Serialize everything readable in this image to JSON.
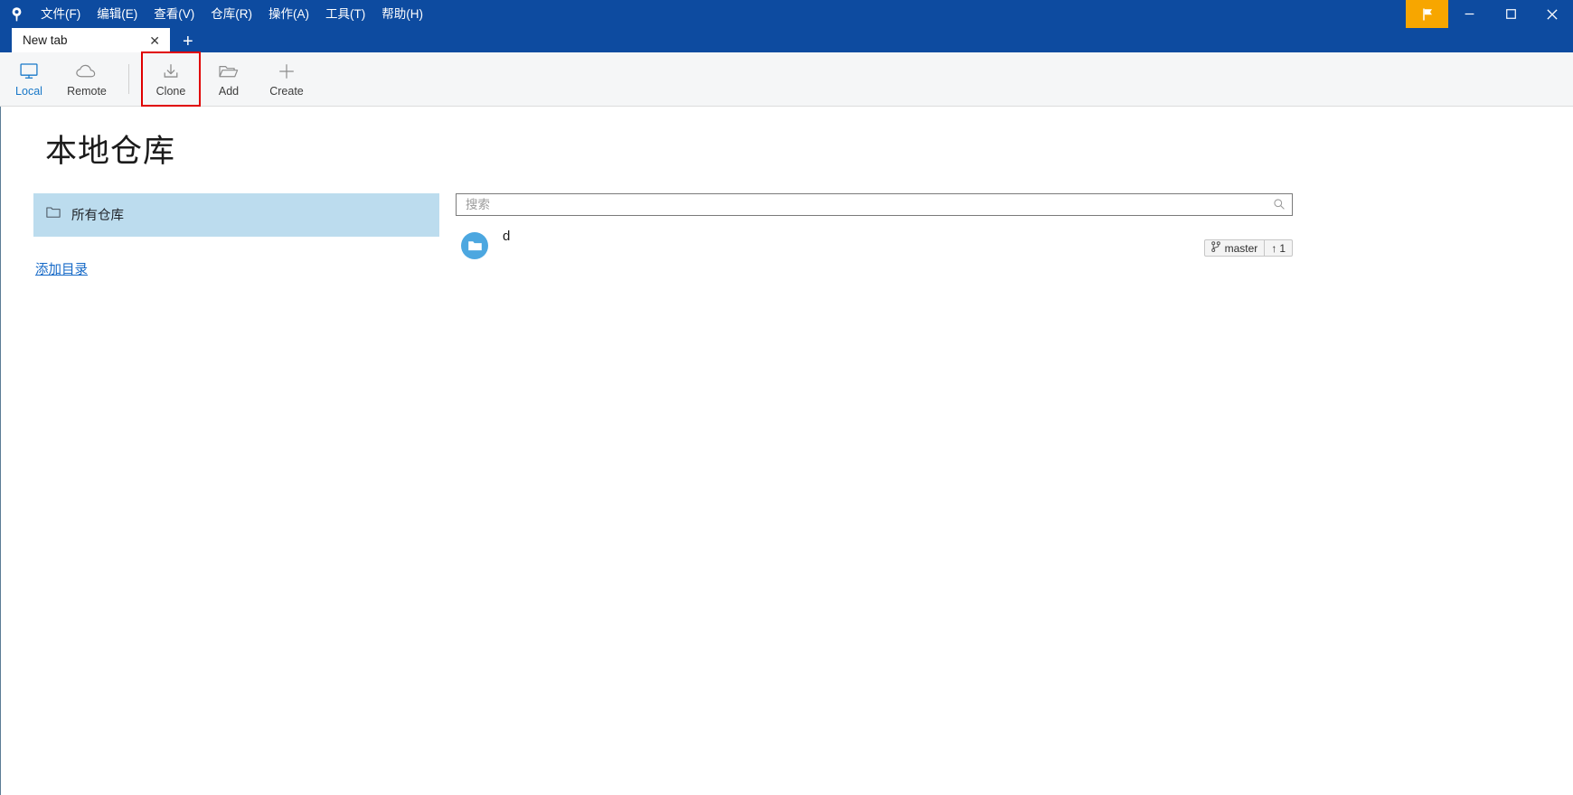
{
  "window": {
    "logo_icon": "smartgit-pin-icon",
    "menus": [
      {
        "label": "文件(F)",
        "name": "menu-file"
      },
      {
        "label": "编辑(E)",
        "name": "menu-edit"
      },
      {
        "label": "查看(V)",
        "name": "menu-view"
      },
      {
        "label": "仓库(R)",
        "name": "menu-repository"
      },
      {
        "label": "操作(A)",
        "name": "menu-actions"
      },
      {
        "label": "工具(T)",
        "name": "menu-tools"
      },
      {
        "label": "帮助(H)",
        "name": "menu-help"
      }
    ],
    "controls": {
      "flag_icon": "flag-icon",
      "minimize_icon": "minimize-icon",
      "maximize_icon": "maximize-icon",
      "close_icon": "close-icon"
    },
    "accent_color": "#0d4ba0",
    "flag_color": "#f7a600"
  },
  "tabs": {
    "items": [
      {
        "label": "New tab",
        "close_glyph": "✕"
      }
    ],
    "new_tab_glyph": "+"
  },
  "toolbar": {
    "left_buttons": [
      {
        "label": "Local",
        "icon": "monitor-icon",
        "active": true
      },
      {
        "label": "Remote",
        "icon": "cloud-icon",
        "active": false
      }
    ],
    "right_buttons": [
      {
        "label": "Clone",
        "icon": "download-icon",
        "highlighted": true
      },
      {
        "label": "Add",
        "icon": "folder-open-icon",
        "highlighted": false
      },
      {
        "label": "Create",
        "icon": "plus-icon",
        "highlighted": false
      }
    ],
    "highlight_color": "#e00000"
  },
  "main": {
    "title": "本地仓库",
    "left": {
      "group_label": "所有仓库",
      "group_icon": "folder-icon",
      "group_bg": "#bcdcee",
      "add_directory_label": "添加目录",
      "link_color": "#1569c7"
    },
    "right": {
      "search": {
        "placeholder": "搜索",
        "value": "",
        "icon": "search-icon"
      },
      "repositories": [
        {
          "name": "d",
          "avatar_icon": "folder-icon",
          "avatar_color": "#4ca7e0",
          "branch": "master",
          "branch_icon": "branch-icon",
          "ahead_glyph": "↑",
          "ahead_count": "1"
        }
      ]
    }
  }
}
